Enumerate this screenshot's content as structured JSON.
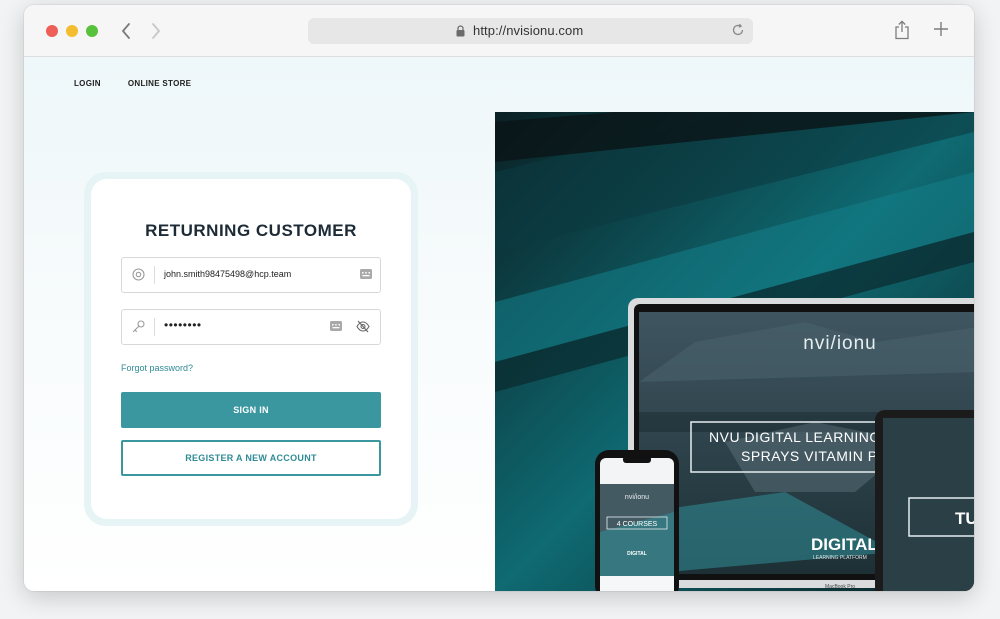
{
  "browser": {
    "url": "http://nvisionu.com"
  },
  "nav": {
    "login": "LOGIN",
    "store": "ONLINE STORE"
  },
  "login_card": {
    "title": "RETURNING CUSTOMER",
    "email_value": "john.smith98475498@hcp.team",
    "password_mask": "••••••••",
    "forgot": "Forgot password?",
    "signin": "SIGN IN",
    "register": "REGISTER A NEW ACCOUNT"
  },
  "hero": {
    "laptop_logo": "nvi/ionu",
    "laptop_banner_line1": "NVU DIGITAL LEARNING",
    "laptop_banner_line2": "SPRAYS VITAMIN PR",
    "laptop_brand_big": "DIGITAL",
    "laptop_brand_small": "LEARNING PLATFORM",
    "laptop_model": "MacBook Pro",
    "phone_logo": "nvi/ionu",
    "phone_courses": "4 COURSES",
    "phone_digital": "DIGITAL",
    "tablet_text": "TU"
  },
  "colors": {
    "accent": "#3a969f",
    "title": "#1d2b36"
  }
}
